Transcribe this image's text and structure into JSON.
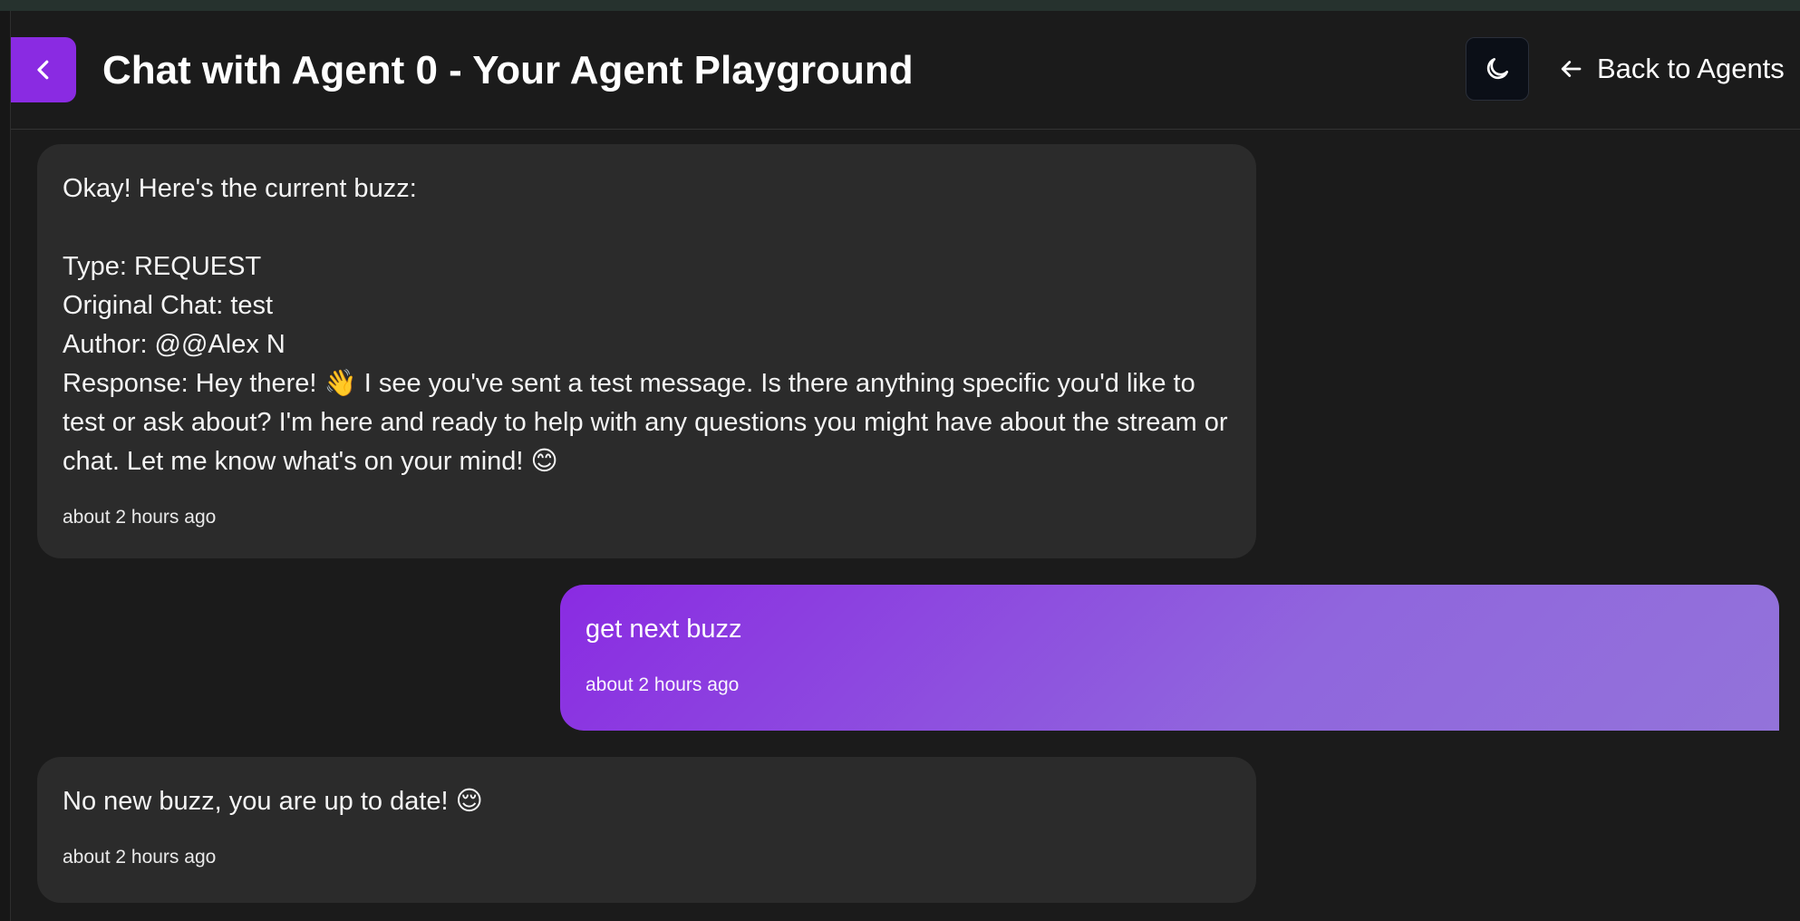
{
  "header": {
    "title": "Chat with Agent 0 - Your Agent Playground",
    "back_to_agents_label": "Back to Agents"
  },
  "icons": {
    "back": "chevron-left-icon",
    "theme": "moon-icon",
    "back_arrow": "arrow-left-icon"
  },
  "colors": {
    "accent": "#8a2be2",
    "background": "#1b1b1b",
    "agent_bubble": "#2b2b2b",
    "user_bubble_gradient_end": "#9373da"
  },
  "messages": [
    {
      "role": "agent",
      "text": "Okay! Here's the current buzz:\n\nType: REQUEST\nOriginal Chat: test\nAuthor: @@Alex N\nResponse: Hey there! 👋 I see you've sent a test message. Is there anything specific you'd like to test or ask about? I'm here and ready to help with any questions you might have about the stream or chat. Let me know what's on your mind! 😊",
      "time": "about 2 hours ago"
    },
    {
      "role": "user",
      "text": "get next buzz",
      "time": "about 2 hours ago"
    },
    {
      "role": "agent",
      "text": "No new buzz, you are up to date! 😌",
      "time": "about 2 hours ago"
    }
  ]
}
